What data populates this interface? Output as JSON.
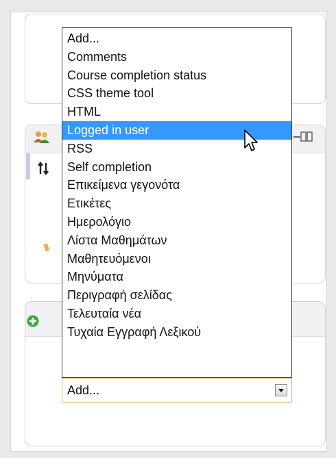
{
  "dropdown": {
    "options": [
      "Add...",
      "Comments",
      "Course completion status",
      "CSS theme tool",
      "HTML",
      "Logged in user",
      "RSS",
      "Self completion",
      "Επικείμενα γεγονότα",
      "Ετικέτες",
      "Ημερολόγιο",
      "Λίστα Μαθημάτων",
      "Μαθητευόμενοι",
      "Μηνύματα",
      "Περιγραφή σελίδας",
      "Τελευταία νέα",
      "Τυχαία Εγγραφή Λεξικού"
    ],
    "highlighted": "Logged in user"
  },
  "select": {
    "value": "Add..."
  },
  "icons": {
    "users_block": "users-icon",
    "move": "move-icon",
    "edit": "pencil-icon",
    "add_block": "add-block-icon",
    "dock": "dock-icon",
    "cursor": "mouse-pointer-icon",
    "dropdown": "chevron-down-icon"
  },
  "colors": {
    "highlight": "#3399ff",
    "add_icon": "#39a935",
    "select_border": "#e0b26a"
  }
}
